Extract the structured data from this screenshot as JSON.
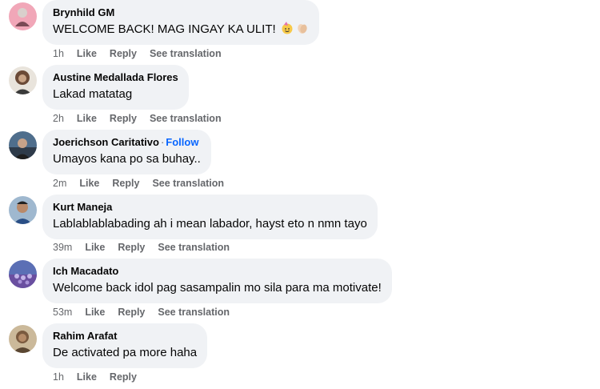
{
  "actions": {
    "like": "Like",
    "reply": "Reply",
    "see_translation": "See translation",
    "follow": "Follow",
    "separator": "·"
  },
  "comments": [
    {
      "author": "Brynhild GM",
      "text": "WELCOME BACK! MAG INGAY KA ULIT!",
      "time": "1h",
      "emojis": [
        "face-with-party-hat",
        "clapping-hands"
      ]
    },
    {
      "author": "Austine Medallada Flores",
      "text": "Lakad matatag",
      "time": "2h"
    },
    {
      "author": "Joerichson Caritativo",
      "text": "Umayos kana po sa buhay..",
      "time": "2m"
    },
    {
      "author": "Kurt Maneja",
      "text": "Lablablablabading ah i mean labador, hayst eto n nmn tayo",
      "time": "39m"
    },
    {
      "author": "Ich Macadato",
      "text": "Welcome back idol pag sasampalin mo sila para ma motivate!",
      "time": "53m"
    },
    {
      "author": "Rahim Arafat",
      "text": "De activated pa more haha",
      "time": "1h"
    }
  ]
}
